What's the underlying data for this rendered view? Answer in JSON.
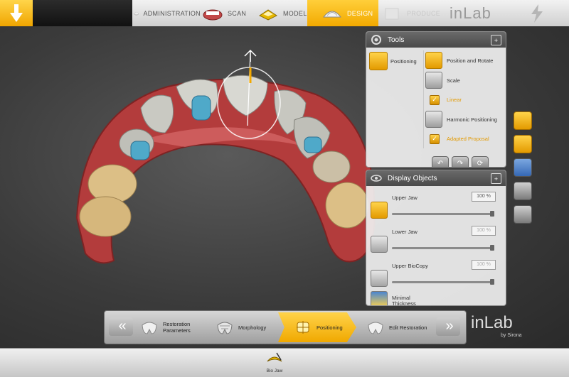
{
  "topbar": {
    "stages": [
      {
        "label": "ADMINISTRATION",
        "state": "done"
      },
      {
        "label": "SCAN",
        "state": "done"
      },
      {
        "label": "MODEL",
        "state": "done"
      },
      {
        "label": "DESIGN",
        "state": "active"
      },
      {
        "label": "PRODUCE",
        "state": "disabled"
      }
    ],
    "brand": "inLab"
  },
  "tools_panel": {
    "title": "Tools",
    "category": "Positioning",
    "items": [
      {
        "label": "Position and Rotate",
        "type": "tool",
        "icon": "position-rotate-icon"
      },
      {
        "label": "Scale",
        "type": "tool",
        "icon": "scale-icon"
      },
      {
        "label": "Linear",
        "type": "checkbox",
        "checked": true
      },
      {
        "label": "Harmonic Positioning",
        "type": "tool",
        "icon": "harmonic-icon"
      },
      {
        "label": "Adapted Proposal",
        "type": "checkbox",
        "checked": true
      }
    ]
  },
  "display_panel": {
    "title": "Display Objects",
    "objects": [
      {
        "label": "Upper Jaw",
        "percent": "100 %",
        "level": 1.0
      },
      {
        "label": "Lower Jaw",
        "percent": "100 %",
        "level": 1.0
      },
      {
        "label": "Upper BioCopy",
        "percent": "100 %",
        "level": 1.0
      },
      {
        "label": "Minimal Thickness",
        "percent": "",
        "level": 0
      }
    ]
  },
  "workflow": {
    "steps": [
      {
        "label": "Restoration Parameters",
        "active": false
      },
      {
        "label": "Morphology",
        "active": false
      },
      {
        "label": "Positioning",
        "active": true
      },
      {
        "label": "Edit Restoration",
        "active": false
      }
    ],
    "brand": "inLab",
    "brand_sub": "by Sirona"
  },
  "bottombar": {
    "item_label": "Bio Jaw"
  },
  "colors": {
    "accent": "#f2a900",
    "gum": "#b83a3a",
    "crown": "#c9c9c2",
    "prep": "#4fa9c9"
  }
}
